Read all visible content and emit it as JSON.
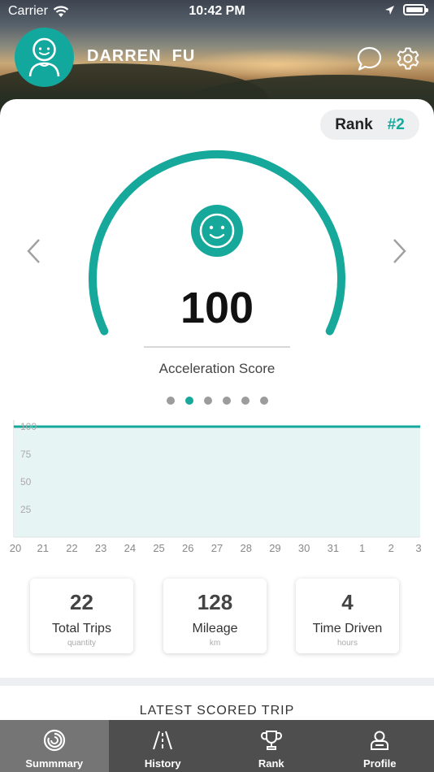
{
  "status_bar": {
    "carrier": "Carrier",
    "time": "10:42 PM"
  },
  "profile": {
    "name": "DARREN  FU"
  },
  "rank": {
    "label": "Rank",
    "value": "#2"
  },
  "gauge": {
    "score": "100",
    "score_label": "Acceleration Score",
    "fill_fraction": 1.0,
    "accent_color": "#16a89b"
  },
  "pager": {
    "count": 6,
    "active_index": 1
  },
  "chart_data": {
    "type": "area",
    "x": [
      "20",
      "21",
      "22",
      "23",
      "24",
      "25",
      "26",
      "27",
      "28",
      "29",
      "30",
      "31",
      "1",
      "2",
      "3"
    ],
    "values": [
      100,
      100,
      100,
      100,
      100,
      100,
      100,
      100,
      100,
      100,
      100,
      100,
      100,
      100,
      100
    ],
    "yticks": [
      "100",
      "75",
      "50",
      "25"
    ],
    "ylim": [
      0,
      100
    ],
    "grid": false,
    "line_color": "#16a89b",
    "fill_color": "#e6f5f3"
  },
  "stats": [
    {
      "value": "22",
      "label": "Total Trips",
      "unit": "quantity"
    },
    {
      "value": "128",
      "label": "Mileage",
      "unit": "km"
    },
    {
      "value": "4",
      "label": "Time Driven",
      "unit": "hours"
    }
  ],
  "latest_trip": {
    "title": "LATEST SCORED TRIP"
  },
  "tabs": [
    {
      "label": "Summmary",
      "icon": "summary-icon",
      "active": true
    },
    {
      "label": "History",
      "icon": "road-icon",
      "active": false
    },
    {
      "label": "Rank",
      "icon": "trophy-icon",
      "active": false
    },
    {
      "label": "Profile",
      "icon": "profile-icon",
      "active": false
    }
  ]
}
